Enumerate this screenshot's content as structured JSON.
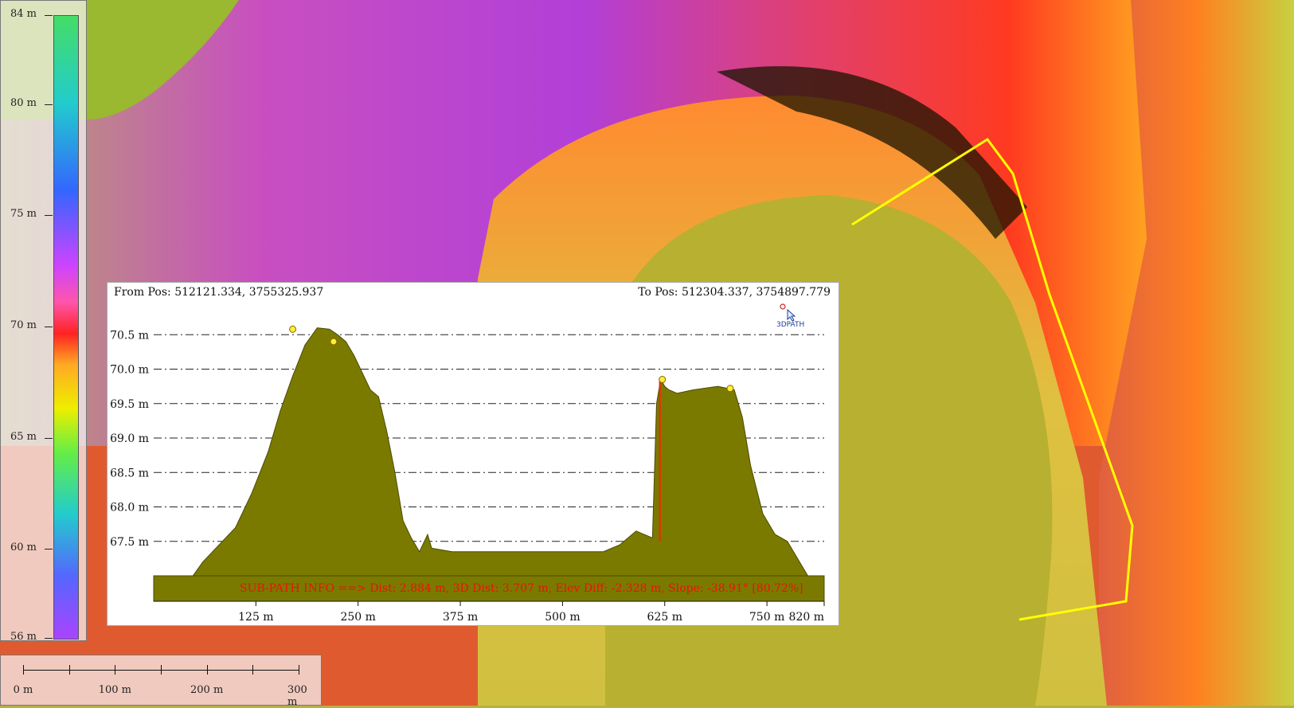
{
  "map": {
    "path_line_color": "#ffff00",
    "basin_color": "#b8b030"
  },
  "legend": {
    "ticks": [
      "84 m",
      "80 m",
      "75 m",
      "70 m",
      "65 m",
      "60 m",
      "56 m"
    ],
    "tick_values": [
      84,
      80,
      75,
      70,
      65,
      60,
      56
    ],
    "min": 56,
    "max": 84
  },
  "scale_bar": {
    "labels": [
      "0 m",
      "100 m",
      "200 m",
      "300 m"
    ],
    "values": [
      0,
      100,
      200,
      300
    ]
  },
  "profile": {
    "from_pos": "From Pos: 512121.334, 3755325.937",
    "to_pos": "To Pos: 512304.337, 3754897.779",
    "threed_button_label": "3DPATH",
    "sub_path_info": "SUB-PATH INFO ==> Dist: 2.884 m, 3D Dist: 3.707 m, Elev Diff: -2.328 m, Slope: -38.91° [80.72%]",
    "fill_color": "#7a7a00",
    "marker_color": "#ffee33",
    "subpath_color": "#ff2200"
  },
  "chart_data": {
    "type": "area",
    "title": "",
    "xlabel": "",
    "ylabel": "",
    "xlim": [
      0,
      820
    ],
    "ylim": [
      67.0,
      70.7
    ],
    "yticks": [
      70.5,
      70.0,
      69.5,
      69.0,
      68.5,
      68.0,
      67.5
    ],
    "ytick_labels": [
      "70.5 m",
      "70.0 m",
      "69.5 m",
      "69.0 m",
      "68.5 m",
      "68.0 m",
      "67.5 m"
    ],
    "xticks": [
      125,
      250,
      375,
      500,
      625,
      750,
      820
    ],
    "xtick_labels": [
      "125 m",
      "250 m",
      "375 m",
      "500 m",
      "625 m",
      "750 m",
      "820 m"
    ],
    "grid": true,
    "series": [
      {
        "x": [
          0,
          48,
          60,
          80,
          100,
          120,
          140,
          155,
          170,
          185,
          200,
          215,
          225,
          235,
          245,
          255,
          265,
          275,
          285,
          295,
          305,
          315,
          325,
          335,
          340,
          365,
          550,
          570,
          590,
          610,
          615,
          620,
          625,
          630,
          640,
          660,
          690,
          710,
          720,
          730,
          745,
          760,
          775,
          790,
          800,
          820
        ],
        "y": [
          67.0,
          67.0,
          67.2,
          67.45,
          67.7,
          68.2,
          68.8,
          69.4,
          69.9,
          70.35,
          70.6,
          70.58,
          70.5,
          70.4,
          70.2,
          69.95,
          69.7,
          69.6,
          69.1,
          68.5,
          67.8,
          67.55,
          67.35,
          67.6,
          67.4,
          67.35,
          67.35,
          67.45,
          67.65,
          67.55,
          69.5,
          69.85,
          69.75,
          69.7,
          69.65,
          69.7,
          69.75,
          69.7,
          69.3,
          68.6,
          67.9,
          67.6,
          67.5,
          67.2,
          67.0,
          67.0
        ]
      }
    ],
    "markers": [
      {
        "x": 170,
        "y": 70.58
      },
      {
        "x": 220,
        "y": 70.4
      },
      {
        "x": 622,
        "y": 69.85
      },
      {
        "x": 705,
        "y": 69.72
      }
    ],
    "subpath_marker_x": 619
  }
}
